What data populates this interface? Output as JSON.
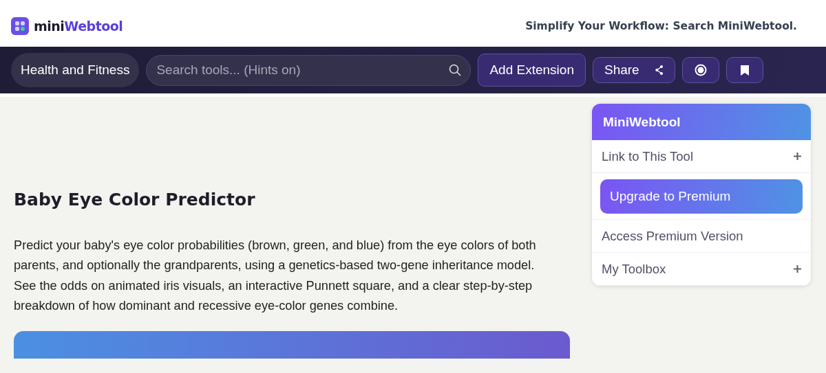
{
  "header": {
    "logo": {
      "prefix": "mini",
      "suffix": "Webtool"
    },
    "tagline": "Simplify Your Workflow: Search MiniWebtool."
  },
  "toolbar": {
    "category": "Health and Fitness",
    "search": {
      "placeholder": "Search tools... (Hints on)"
    },
    "buttons": [
      {
        "kind": "text",
        "label": "Add Extension"
      },
      {
        "kind": "share",
        "label": "Share"
      },
      {
        "kind": "record"
      },
      {
        "kind": "bookmark"
      }
    ]
  },
  "main": {
    "title": "Baby Eye Color Predictor",
    "description": "Predict your baby's eye color probabilities (brown, green, and blue) from the eye colors of both parents, and optionally the grandparents, using a genetics-based two-gene inheritance model. See the odds on animated iris visuals, an interactive Punnett square, and a clear step-by-step breakdown of how dominant and recessive eye-color genes combine."
  },
  "sidebar": {
    "title": "MiniWebtool",
    "items": [
      {
        "kind": "expandable",
        "label": "Link to This Tool"
      },
      {
        "kind": "promo",
        "label": "Upgrade to Premium"
      },
      {
        "kind": "link",
        "label": "Access Premium Version"
      },
      {
        "kind": "expandable",
        "label": "My Toolbox"
      }
    ]
  }
}
